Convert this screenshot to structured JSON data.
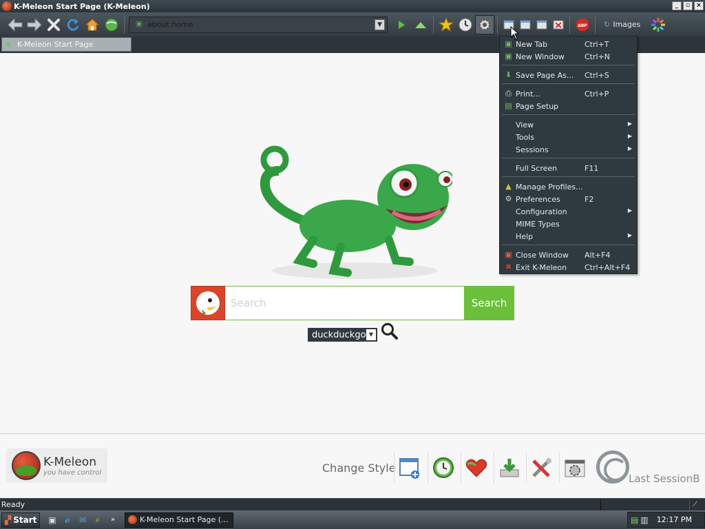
{
  "window": {
    "title": "K-Meleon Start Page (K-Meleon)"
  },
  "toolbar": {
    "url": "about:home",
    "images_label": "Images"
  },
  "tab": {
    "title": "K-Meleon Start Page"
  },
  "search": {
    "placeholder": "Search",
    "button_label": "Search",
    "engine": "duckduckgo"
  },
  "bottom": {
    "logo_name": "K-Meleon",
    "logo_tagline": "you have control",
    "change_style": "Change Style",
    "last_session": "Last SessionB"
  },
  "status": {
    "text": "Ready"
  },
  "taskbar": {
    "start_label": "Start",
    "task_label": "K-Meleon Start Page (...",
    "clock": "12:17 PM"
  },
  "menu": {
    "items": [
      {
        "label": "New Tab",
        "shortcut": "Ctrl+T",
        "icon": "new-tab-icon"
      },
      {
        "label": "New Window",
        "shortcut": "Ctrl+N",
        "icon": "new-window-icon"
      },
      {
        "label": "Save Page As...",
        "shortcut": "Ctrl+S",
        "icon": "save-icon"
      },
      {
        "label": "Print...",
        "shortcut": "Ctrl+P",
        "icon": "print-icon"
      },
      {
        "label": "Page Setup",
        "shortcut": "",
        "icon": "page-setup-icon"
      },
      {
        "label": "View",
        "shortcut": "",
        "icon": ""
      },
      {
        "label": "Tools",
        "shortcut": "",
        "icon": ""
      },
      {
        "label": "Sessions",
        "shortcut": "",
        "icon": ""
      },
      {
        "label": "Full Screen",
        "shortcut": "F11",
        "icon": ""
      },
      {
        "label": "Manage Profiles...",
        "shortcut": "",
        "icon": "profiles-icon"
      },
      {
        "label": "Preferences",
        "shortcut": "F2",
        "icon": "gear-icon"
      },
      {
        "label": "Configuration",
        "shortcut": "",
        "icon": ""
      },
      {
        "label": "MIME Types",
        "shortcut": "",
        "icon": ""
      },
      {
        "label": "Help",
        "shortcut": "",
        "icon": ""
      },
      {
        "label": "Close Window",
        "shortcut": "Alt+F4",
        "icon": "close-window-icon"
      },
      {
        "label": "Exit K-Meleon",
        "shortcut": "Ctrl+Alt+F4",
        "icon": "exit-icon"
      }
    ]
  }
}
